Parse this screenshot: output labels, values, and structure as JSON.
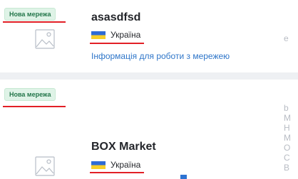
{
  "networks": [
    {
      "badge": "Нова мережа",
      "name": "asasdfsd",
      "country": "Україна",
      "info_link": "Інформація для роботи з мережею",
      "side_text": "e"
    },
    {
      "badge": "Нова мережа",
      "name": "BOX Market",
      "country": "Україна",
      "side_text_lines": [
        "b",
        "M",
        "H",
        "M",
        "O",
        "C",
        "B"
      ]
    }
  ],
  "colors": {
    "badge_bg": "#dff3e7",
    "badge_text": "#23764a",
    "link": "#2f76c9",
    "underline": "#e21f26"
  },
  "icons": {
    "thumbnail": "image-placeholder-icon",
    "flag": "ukraine-flag-icon"
  }
}
